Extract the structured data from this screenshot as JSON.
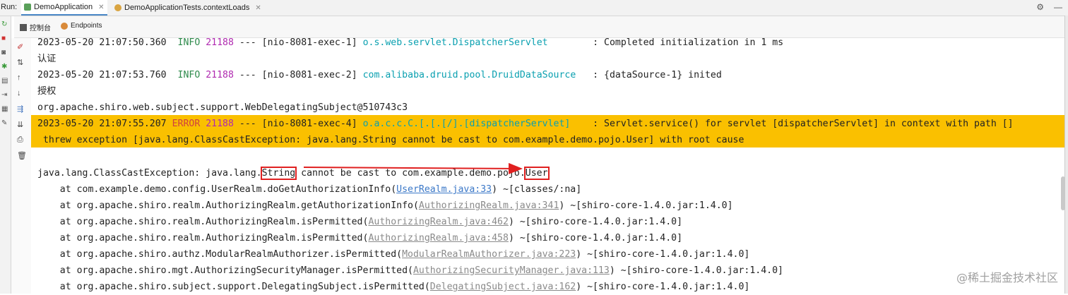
{
  "topbar": {
    "run_label": "Run:",
    "tabs": [
      {
        "label": "DemoApplication",
        "active": true
      },
      {
        "label": "DemoApplicationTests.contextLoads",
        "active": false
      }
    ]
  },
  "subtabs": [
    {
      "label": "控制台"
    },
    {
      "label": "Endpoints"
    }
  ],
  "console": {
    "l1": {
      "ts": "2023-05-20 21:07:50.360",
      "level": "INFO",
      "pid": "21188",
      "sep": "---",
      "thread": "[nio-8081-exec-1]",
      "logger": "o.s.web.servlet.DispatcherServlet       ",
      "msg": ": Completed initialization in 1 ms"
    },
    "l2": "认证",
    "l3": {
      "ts": "2023-05-20 21:07:53.760",
      "level": "INFO",
      "pid": "21188",
      "sep": "---",
      "thread": "[nio-8081-exec-2]",
      "logger": "com.alibaba.druid.pool.DruidDataSource  ",
      "msg": ": {dataSource-1} inited"
    },
    "l4": "授权",
    "l5": "org.apache.shiro.web.subject.support.WebDelegatingSubject@510743c3",
    "l6": {
      "ts": "2023-05-20 21:07:55.207",
      "level": "ERROR",
      "pid": "21188",
      "sep": "---",
      "thread": "[nio-8081-exec-4]",
      "logger": "o.a.c.c.C.[.[.[/].[dispatcherServlet]   ",
      "msg": ": Servlet.service() for servlet [dispatcherServlet] in context with path []"
    },
    "l7": " threw exception [java.lang.ClassCastException: java.lang.String cannot be cast to com.example.demo.pojo.User] with root cause",
    "ex": {
      "pre": "java.lang.ClassCastException: java.lang.",
      "w1": "String",
      "mid": " cannot be cast to com.example.demo.pojo.",
      "w2": "User"
    },
    "frames": [
      {
        "pre": "    at com.example.demo.config.UserRealm.doGetAuthorizationInfo(",
        "link": "UserRealm.java:33",
        "post": ") ~[classes/:na]"
      },
      {
        "pre": "    at org.apache.shiro.realm.AuthorizingRealm.getAuthorizationInfo(",
        "link": "AuthorizingRealm.java:341",
        "post": ") ~[shiro-core-1.4.0.jar:1.4.0]"
      },
      {
        "pre": "    at org.apache.shiro.realm.AuthorizingRealm.isPermitted(",
        "link": "AuthorizingRealm.java:462",
        "post": ") ~[shiro-core-1.4.0.jar:1.4.0]"
      },
      {
        "pre": "    at org.apache.shiro.realm.AuthorizingRealm.isPermitted(",
        "link": "AuthorizingRealm.java:458",
        "post": ") ~[shiro-core-1.4.0.jar:1.4.0]"
      },
      {
        "pre": "    at org.apache.shiro.authz.ModularRealmAuthorizer.isPermitted(",
        "link": "ModularRealmAuthorizer.java:223",
        "post": ") ~[shiro-core-1.4.0.jar:1.4.0]"
      },
      {
        "pre": "    at org.apache.shiro.mgt.AuthorizingSecurityManager.isPermitted(",
        "link": "AuthorizingSecurityManager.java:113",
        "post": ") ~[shiro-core-1.4.0.jar:1.4.0]"
      },
      {
        "pre": "    at org.apache.shiro.subject.support.DelegatingSubject.isPermitted(",
        "link": "DelegatingSubject.java:162",
        "post": ") ~[shiro-core-1.4.0.jar:1.4.0]"
      }
    ]
  },
  "watermark": "@稀土掘金技术社区",
  "colors": {
    "highlight": "#fac000",
    "info": "#2f8b4c",
    "pid": "#b02ab0",
    "logger": "#0aa0b0",
    "error": "#d04040",
    "annotation": "#e02020"
  }
}
